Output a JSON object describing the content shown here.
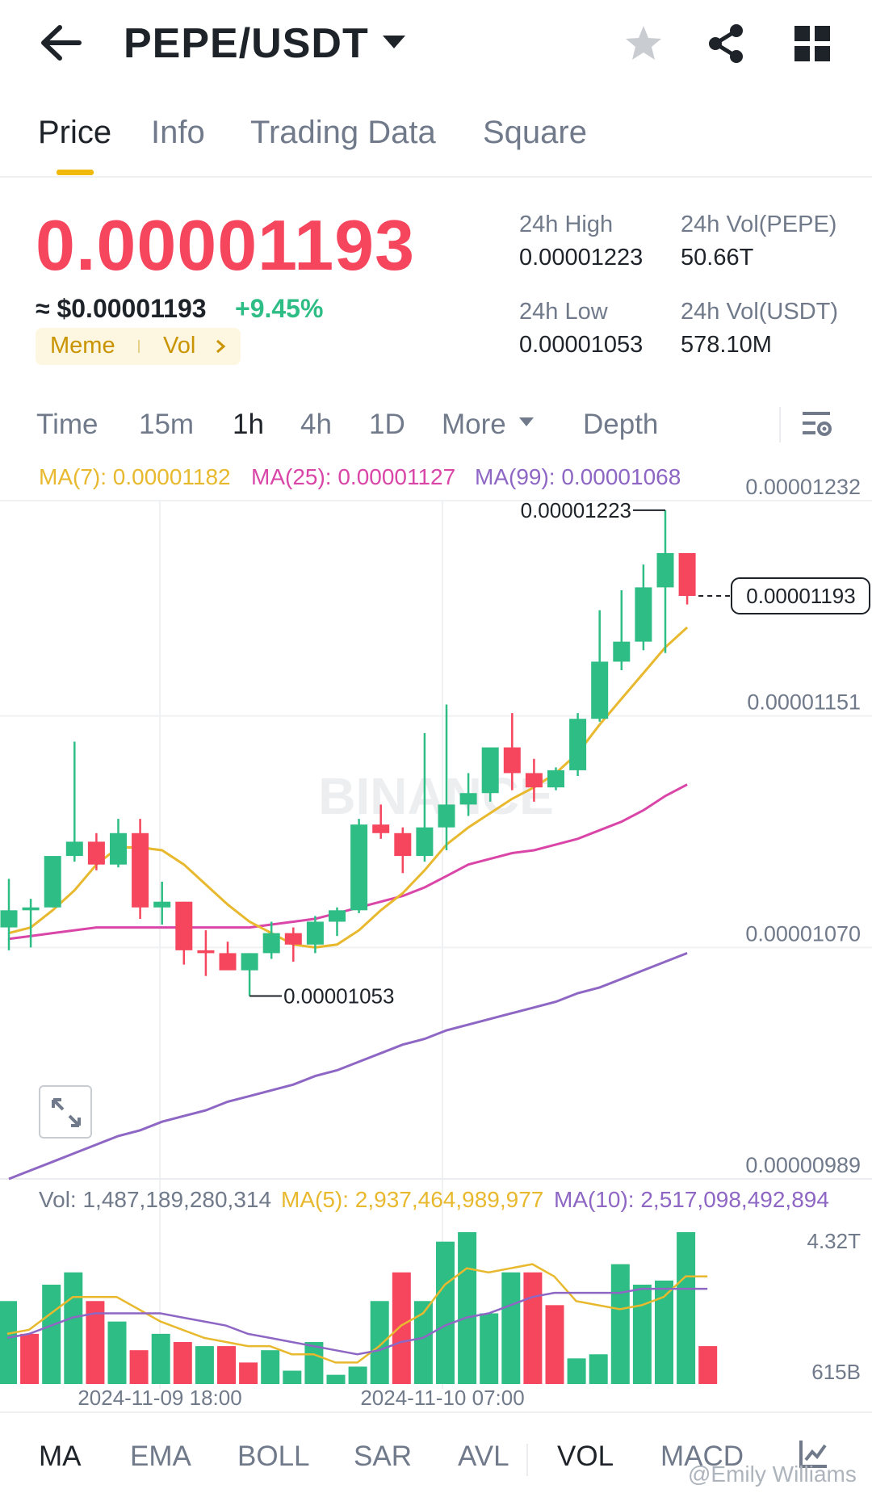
{
  "header": {
    "pair": "PEPE/USDT",
    "icons": [
      "back-arrow-icon",
      "caret-down-icon",
      "star-icon",
      "share-icon",
      "grid-icon"
    ]
  },
  "tabs": [
    {
      "label": "Price",
      "active": true
    },
    {
      "label": "Info",
      "active": false
    },
    {
      "label": "Trading Data",
      "active": false
    },
    {
      "label": "Square",
      "active": false
    }
  ],
  "price": {
    "last": "0.00001193",
    "fiat": "≈ $0.00001193",
    "change": "+9.45%",
    "tags": [
      "Meme",
      "Vol"
    ],
    "stats": {
      "high_label": "24h High",
      "high": "0.00001223",
      "low_label": "24h Low",
      "low": "0.00001053",
      "vol_base_label": "24h Vol(PEPE)",
      "vol_base": "50.66T",
      "vol_quote_label": "24h Vol(USDT)",
      "vol_quote": "578.10M"
    }
  },
  "intervals": {
    "items": [
      {
        "label": "Time",
        "active": false
      },
      {
        "label": "15m",
        "active": false
      },
      {
        "label": "1h",
        "active": true
      },
      {
        "label": "4h",
        "active": false
      },
      {
        "label": "1D",
        "active": false
      },
      {
        "label": "More",
        "active": false
      },
      {
        "label": "Depth",
        "active": false
      }
    ]
  },
  "ma_legend": {
    "ma7": "MA(7): 0.00001182",
    "ma25": "MA(25): 0.00001127",
    "ma99": "MA(99): 0.00001068"
  },
  "vol_legend": {
    "vol": "Vol: 1,487,189,280,314",
    "ma5": "MA(5): 2,937,464,989,977",
    "ma10": "MA(10): 2,517,098,492,894"
  },
  "chart_data": {
    "type": "candlestick",
    "y_ticks": [
      "0.00001232",
      "0.00001151",
      "0.00001070",
      "0.00000989"
    ],
    "y_range": [
      9.89e-06,
      1.232e-05
    ],
    "x_ticks": [
      "2024-11-09 18:00",
      "2024-11-10 07:00"
    ],
    "high_label": "0.00001223",
    "low_label": "0.00001053",
    "last_label": "0.00001193",
    "watermark": "BINANCE",
    "colors": {
      "up": "#2ebd85",
      "down": "#f6465d",
      "ma7": "#e8b92e",
      "ma25": "#d946a8",
      "ma99": "#8e66c4"
    },
    "candles": [
      {
        "o": 1.077e-05,
        "h": 1.094e-05,
        "l": 1.069e-05,
        "c": 1.083e-05
      },
      {
        "o": 1.083e-05,
        "h": 1.087e-05,
        "l": 1.07e-05,
        "c": 1.084e-05
      },
      {
        "o": 1.084e-05,
        "h": 1.1e-05,
        "l": 1.084e-05,
        "c": 1.102e-05
      },
      {
        "o": 1.102e-05,
        "h": 1.142e-05,
        "l": 1.1e-05,
        "c": 1.107e-05
      },
      {
        "o": 1.107e-05,
        "h": 1.11e-05,
        "l": 1.097e-05,
        "c": 1.099e-05
      },
      {
        "o": 1.099e-05,
        "h": 1.115e-05,
        "l": 1.098e-05,
        "c": 1.11e-05
      },
      {
        "o": 1.11e-05,
        "h": 1.115e-05,
        "l": 1.08e-05,
        "c": 1.084e-05
      },
      {
        "o": 1.084e-05,
        "h": 1.093e-05,
        "l": 1.078e-05,
        "c": 1.086e-05
      },
      {
        "o": 1.086e-05,
        "h": 1.086e-05,
        "l": 1.064e-05,
        "c": 1.069e-05
      },
      {
        "o": 1.069e-05,
        "h": 1.076e-05,
        "l": 1.06e-05,
        "c": 1.068e-05
      },
      {
        "o": 1.068e-05,
        "h": 1.072e-05,
        "l": 1.063e-05,
        "c": 1.062e-05
      },
      {
        "o": 1.062e-05,
        "h": 1.068e-05,
        "l": 1.053e-05,
        "c": 1.068e-05
      },
      {
        "o": 1.068e-05,
        "h": 1.079e-05,
        "l": 1.066e-05,
        "c": 1.075e-05
      },
      {
        "o": 1.075e-05,
        "h": 1.077e-05,
        "l": 1.065e-05,
        "c": 1.071e-05
      },
      {
        "o": 1.071e-05,
        "h": 1.081e-05,
        "l": 1.068e-05,
        "c": 1.079e-05
      },
      {
        "o": 1.079e-05,
        "h": 1.084e-05,
        "l": 1.074e-05,
        "c": 1.083e-05
      },
      {
        "o": 1.083e-05,
        "h": 1.115e-05,
        "l": 1.082e-05,
        "c": 1.113e-05
      },
      {
        "o": 1.113e-05,
        "h": 1.12e-05,
        "l": 1.108e-05,
        "c": 1.11e-05
      },
      {
        "o": 1.11e-05,
        "h": 1.112e-05,
        "l": 1.096e-05,
        "c": 1.102e-05
      },
      {
        "o": 1.102e-05,
        "h": 1.145e-05,
        "l": 1.1e-05,
        "c": 1.112e-05
      },
      {
        "o": 1.112e-05,
        "h": 1.155e-05,
        "l": 1.104e-05,
        "c": 1.12e-05
      },
      {
        "o": 1.12e-05,
        "h": 1.131e-05,
        "l": 1.116e-05,
        "c": 1.124e-05
      },
      {
        "o": 1.124e-05,
        "h": 1.138e-05,
        "l": 1.121e-05,
        "c": 1.14e-05
      },
      {
        "o": 1.14e-05,
        "h": 1.152e-05,
        "l": 1.125e-05,
        "c": 1.131e-05
      },
      {
        "o": 1.131e-05,
        "h": 1.136e-05,
        "l": 1.121e-05,
        "c": 1.126e-05
      },
      {
        "o": 1.126e-05,
        "h": 1.133e-05,
        "l": 1.125e-05,
        "c": 1.132e-05
      },
      {
        "o": 1.132e-05,
        "h": 1.152e-05,
        "l": 1.13e-05,
        "c": 1.15e-05
      },
      {
        "o": 1.15e-05,
        "h": 1.188e-05,
        "l": 1.149e-05,
        "c": 1.17e-05
      },
      {
        "o": 1.17e-05,
        "h": 1.195e-05,
        "l": 1.167e-05,
        "c": 1.177e-05
      },
      {
        "o": 1.177e-05,
        "h": 1.204e-05,
        "l": 1.174e-05,
        "c": 1.196e-05
      },
      {
        "o": 1.196e-05,
        "h": 1.223e-05,
        "l": 1.173e-05,
        "c": 1.208e-05
      },
      {
        "o": 1.208e-05,
        "h": 1.208e-05,
        "l": 1.19e-05,
        "c": 1.193e-05
      }
    ],
    "ma7": [
      1.075e-05,
      1.077e-05,
      1.083e-05,
      1.09e-05,
      1.099e-05,
      1.105e-05,
      1.105e-05,
      1.104e-05,
      1.099e-05,
      1.092e-05,
      1.085e-05,
      1.079e-05,
      1.075e-05,
      1.071e-05,
      1.07e-05,
      1.071e-05,
      1.076e-05,
      1.083e-05,
      1.089e-05,
      1.097e-05,
      1.106e-05,
      1.112e-05,
      1.117e-05,
      1.122e-05,
      1.126e-05,
      1.131e-05,
      1.138e-05,
      1.148e-05,
      1.157e-05,
      1.166e-05,
      1.175e-05,
      1.182e-05
    ],
    "ma25": [
      1.073e-05,
      1.074e-05,
      1.075e-05,
      1.076e-05,
      1.077e-05,
      1.077e-05,
      1.077e-05,
      1.077e-05,
      1.077e-05,
      1.077e-05,
      1.077e-05,
      1.077e-05,
      1.078e-05,
      1.079e-05,
      1.08e-05,
      1.082e-05,
      1.084e-05,
      1.086e-05,
      1.088e-05,
      1.091e-05,
      1.095e-05,
      1.099e-05,
      1.101e-05,
      1.103e-05,
      1.104e-05,
      1.106e-05,
      1.108e-05,
      1.111e-05,
      1.114e-05,
      1.118e-05,
      1.123e-05,
      1.127e-05
    ],
    "ma99": [
      9.89e-06,
      9.92e-06,
      9.95e-06,
      9.98e-06,
      1.001e-05,
      1.004e-05,
      1.006e-05,
      1.009e-05,
      1.011e-05,
      1.013e-05,
      1.016e-05,
      1.018e-05,
      1.02e-05,
      1.022e-05,
      1.025e-05,
      1.027e-05,
      1.03e-05,
      1.033e-05,
      1.036e-05,
      1.038e-05,
      1.041e-05,
      1.043e-05,
      1.045e-05,
      1.047e-05,
      1.049e-05,
      1.051e-05,
      1.054e-05,
      1.056e-05,
      1.059e-05,
      1.062e-05,
      1.065e-05,
      1.068e-05
    ],
    "volume": {
      "y_ticks": [
        "4.32T",
        "615B"
      ],
      "y_range": [
        0.615,
        4.32
      ],
      "unit": "T",
      "values": [
        2.6,
        1.8,
        3.0,
        3.3,
        2.6,
        2.1,
        1.4,
        1.8,
        1.6,
        1.5,
        1.5,
        1.1,
        1.4,
        0.9,
        1.6,
        0.8,
        1.0,
        2.6,
        3.3,
        2.6,
        4.05,
        4.3,
        2.3,
        3.3,
        3.3,
        2.5,
        1.2,
        1.3,
        3.5,
        3.0,
        3.1,
        4.4,
        1.5
      ],
      "ma5": [
        1.8,
        1.9,
        2.3,
        2.7,
        2.7,
        2.7,
        2.4,
        2.1,
        1.9,
        1.7,
        1.6,
        1.5,
        1.5,
        1.3,
        1.3,
        1.1,
        1.1,
        1.5,
        2.0,
        2.3,
        3.0,
        3.4,
        3.3,
        3.4,
        3.5,
        3.2,
        2.6,
        2.5,
        2.4,
        2.5,
        2.7,
        3.2,
        3.2
      ],
      "ma10": [
        1.7,
        1.8,
        2.0,
        2.2,
        2.3,
        2.3,
        2.3,
        2.3,
        2.2,
        2.1,
        2.0,
        1.8,
        1.7,
        1.6,
        1.5,
        1.4,
        1.3,
        1.4,
        1.6,
        1.7,
        2.0,
        2.2,
        2.3,
        2.5,
        2.7,
        2.8,
        2.8,
        2.8,
        2.8,
        2.9,
        2.9,
        2.9,
        2.9
      ]
    }
  },
  "indicators": [
    {
      "label": "MA",
      "active": true
    },
    {
      "label": "EMA",
      "active": false
    },
    {
      "label": "BOLL",
      "active": false
    },
    {
      "label": "SAR",
      "active": false
    },
    {
      "label": "AVL",
      "active": false
    },
    {
      "label": "VOL",
      "active": true
    },
    {
      "label": "MACD",
      "active": false
    }
  ],
  "watermark_user": "@Emily Williams"
}
